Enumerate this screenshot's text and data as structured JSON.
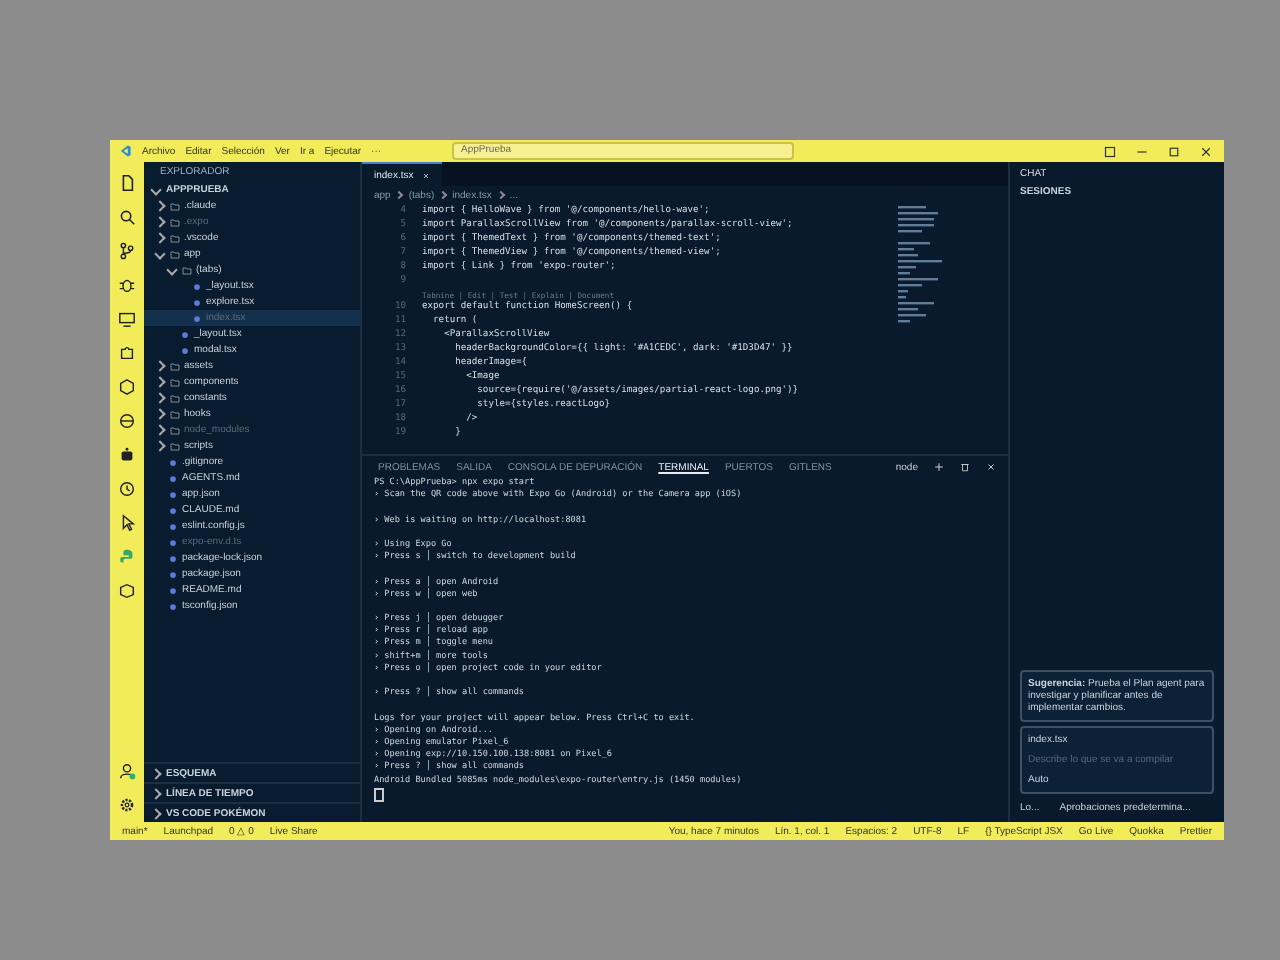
{
  "menu": [
    "Archivo",
    "Editar",
    "Selección",
    "Ver",
    "Ir a",
    "Ejecutar",
    "···"
  ],
  "command_center": {
    "value": "AppPrueba"
  },
  "explorer": {
    "title": "EXPLORADOR",
    "root": "APPPRUEBA",
    "items": [
      {
        "name": ".claude",
        "kind": "folder",
        "expanded": false,
        "dimmed": false
      },
      {
        "name": ".expo",
        "kind": "folder",
        "expanded": false,
        "dimmed": true
      },
      {
        "name": ".vscode",
        "kind": "folder",
        "expanded": false,
        "dimmed": false
      },
      {
        "name": "app",
        "kind": "folder",
        "expanded": true,
        "dimmed": false,
        "children": [
          {
            "name": "(tabs)",
            "kind": "folder",
            "expanded": true,
            "dimmed": false,
            "children": [
              {
                "name": "_layout.tsx",
                "kind": "file",
                "dimmed": false,
                "selected": false
              },
              {
                "name": "explore.tsx",
                "kind": "file",
                "dimmed": false,
                "selected": false
              },
              {
                "name": "index.tsx",
                "kind": "file",
                "dimmed": true,
                "selected": true
              }
            ]
          },
          {
            "name": "_layout.tsx",
            "kind": "file",
            "dimmed": false,
            "selected": false
          },
          {
            "name": "modal.tsx",
            "kind": "file",
            "dimmed": false,
            "selected": false
          }
        ]
      },
      {
        "name": "assets",
        "kind": "folder",
        "expanded": false,
        "dimmed": false
      },
      {
        "name": "components",
        "kind": "folder",
        "expanded": false,
        "dimmed": false
      },
      {
        "name": "constants",
        "kind": "folder",
        "expanded": false,
        "dimmed": false
      },
      {
        "name": "hooks",
        "kind": "folder",
        "expanded": false,
        "dimmed": false
      },
      {
        "name": "node_modules",
        "kind": "folder",
        "expanded": false,
        "dimmed": true
      },
      {
        "name": "scripts",
        "kind": "folder",
        "expanded": false,
        "dimmed": false
      },
      {
        "name": ".gitignore",
        "kind": "file",
        "dimmed": false,
        "selected": false
      },
      {
        "name": "AGENTS.md",
        "kind": "file",
        "dimmed": false,
        "selected": false
      },
      {
        "name": "app.json",
        "kind": "file",
        "dimmed": false,
        "selected": false
      },
      {
        "name": "CLAUDE.md",
        "kind": "file",
        "dimmed": false,
        "selected": false
      },
      {
        "name": "eslint.config.js",
        "kind": "file",
        "dimmed": false,
        "selected": false
      },
      {
        "name": "expo-env.d.ts",
        "kind": "file",
        "dimmed": true,
        "selected": false
      },
      {
        "name": "package-lock.json",
        "kind": "file",
        "dimmed": false,
        "selected": false
      },
      {
        "name": "package.json",
        "kind": "file",
        "dimmed": false,
        "selected": false
      },
      {
        "name": "README.md",
        "kind": "file",
        "dimmed": false,
        "selected": false
      },
      {
        "name": "tsconfig.json",
        "kind": "file",
        "dimmed": false,
        "selected": false
      }
    ],
    "sections": [
      "ESQUEMA",
      "LÍNEA DE TIEMPO",
      "VS CODE POKÉMON"
    ]
  },
  "editor": {
    "tabs": [
      {
        "label": "index.tsx",
        "selected": true
      }
    ],
    "breadcrumb": [
      "app",
      "(tabs)",
      "index.tsx",
      "..."
    ],
    "codelens": "Tabnine | Edit | Test | Explain | Document",
    "lines": [
      {
        "number": "4",
        "text": "import { HelloWave } from '@/components/hello-wave';"
      },
      {
        "number": "5",
        "text": "import ParallaxScrollView from '@/components/parallax-scroll-view';"
      },
      {
        "number": "6",
        "text": "import { ThemedText } from '@/components/themed-text';"
      },
      {
        "number": "7",
        "text": "import { ThemedView } from '@/components/themed-view';"
      },
      {
        "number": "8",
        "text": "import { Link } from 'expo-router';"
      },
      {
        "number": "9"
      },
      {
        "number": "10",
        "text": "export default function HomeScreen() {"
      },
      {
        "number": "11",
        "text": "  return ("
      },
      {
        "number": "12",
        "text": "    <ParallaxScrollView"
      },
      {
        "number": "13",
        "text": "      headerBackgroundColor={{ light: '#A1CEDC', dark: '#1D3D47' }}"
      },
      {
        "number": "14",
        "text": "      headerImage={"
      },
      {
        "number": "15",
        "text": "        <Image"
      },
      {
        "number": "16",
        "text": "          source={require('@/assets/images/partial-react-logo.png')}"
      },
      {
        "number": "17",
        "text": "          style={styles.reactLogo}"
      },
      {
        "number": "18",
        "text": "        />"
      },
      {
        "number": "19",
        "text": "      }"
      }
    ]
  },
  "panel": {
    "tabs": [
      {
        "label": "PROBLEMAS",
        "selected": false
      },
      {
        "label": "SALIDA",
        "selected": false
      },
      {
        "label": "CONSOLA DE DEPURACIÓN",
        "selected": false
      },
      {
        "label": "TERMINAL",
        "selected": true
      },
      {
        "label": "PUERTOS",
        "selected": false
      },
      {
        "label": "GITLENS",
        "selected": false
      }
    ],
    "terminal_name": "node",
    "blocks": [
      [
        "PS C:\\AppPrueba> npx expo start",
        "› Scan the QR code above with Expo Go (Android) or the Camera app (iOS)"
      ],
      [
        "› Web is waiting on http://localhost:8081"
      ],
      [
        "› Using Expo Go",
        "› Press s │ switch to development build"
      ],
      [
        "› Press a │ open Android",
        "› Press w │ open web"
      ],
      [
        "› Press j │ open debugger",
        "› Press r │ reload app",
        "› Press m │ toggle menu",
        "› shift+m │ more tools",
        "› Press o │ open project code in your editor"
      ],
      [
        "› Press ? │ show all commands"
      ],
      [
        "Logs for your project will appear below. Press Ctrl+C to exit.",
        "› Opening on Android...",
        "› Opening emulator Pixel_6",
        "› Opening exp://10.150.100.138:8081 on Pixel_6",
        "› Press ? │ show all commands",
        "Android Bundled 5085ms node_modules\\expo-router\\entry.js (1450 modules)"
      ]
    ]
  },
  "chat": {
    "title": "CHAT",
    "sessions": "SESIONES",
    "suggestion": "**Sugerencia:** Prueba el Plan agent para investigar y planificar antes de implementar cambios.",
    "context": "index.tsx",
    "placeholder": "Describe lo que se va a compilar",
    "mode": "Auto",
    "footer": [
      "Lo...",
      "Aprobaciones predetermina..."
    ]
  },
  "status_bar": {
    "left": [
      "main*",
      "Launchpad",
      "0 △ 0",
      "Live Share"
    ],
    "right": [
      "You, hace 7 minutos",
      "Lín. 1, col. 1",
      "Espacios: 2",
      "UTF-8",
      "LF",
      "{} TypeScript JSX",
      "Go Live",
      "Quokka",
      "Prettier"
    ]
  }
}
